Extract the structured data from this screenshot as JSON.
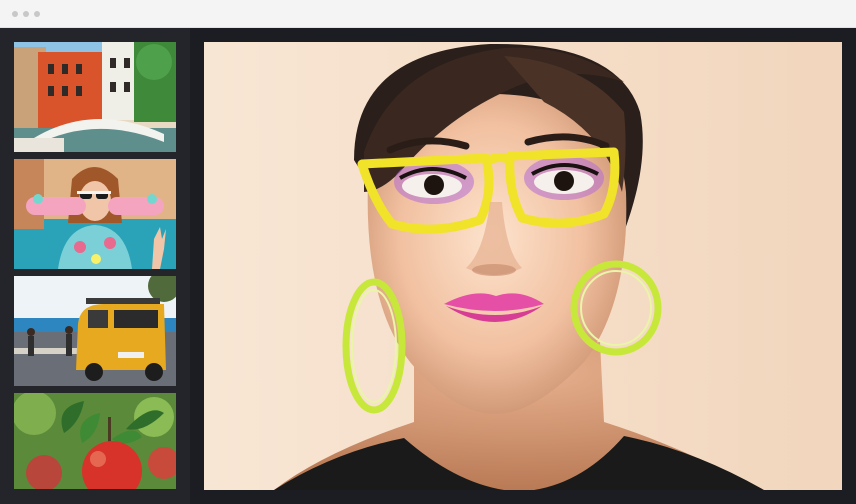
{
  "window": {
    "controls": [
      "close-dot",
      "minimize-dot",
      "maximize-dot"
    ]
  },
  "gallery": {
    "thumbnails": [
      {
        "subject": "venice-canal"
      },
      {
        "subject": "woman-skateboard"
      },
      {
        "subject": "yellow-van-beach"
      },
      {
        "subject": "red-apple"
      }
    ],
    "selected_index": 1
  },
  "preview": {
    "subject": "woman-yellow-glasses-portrait"
  },
  "colors": {
    "titlebar": "#f4f4f4",
    "sidebar": "#24252b",
    "background": "#1c1d22",
    "canvas": "#f6e0cc"
  }
}
